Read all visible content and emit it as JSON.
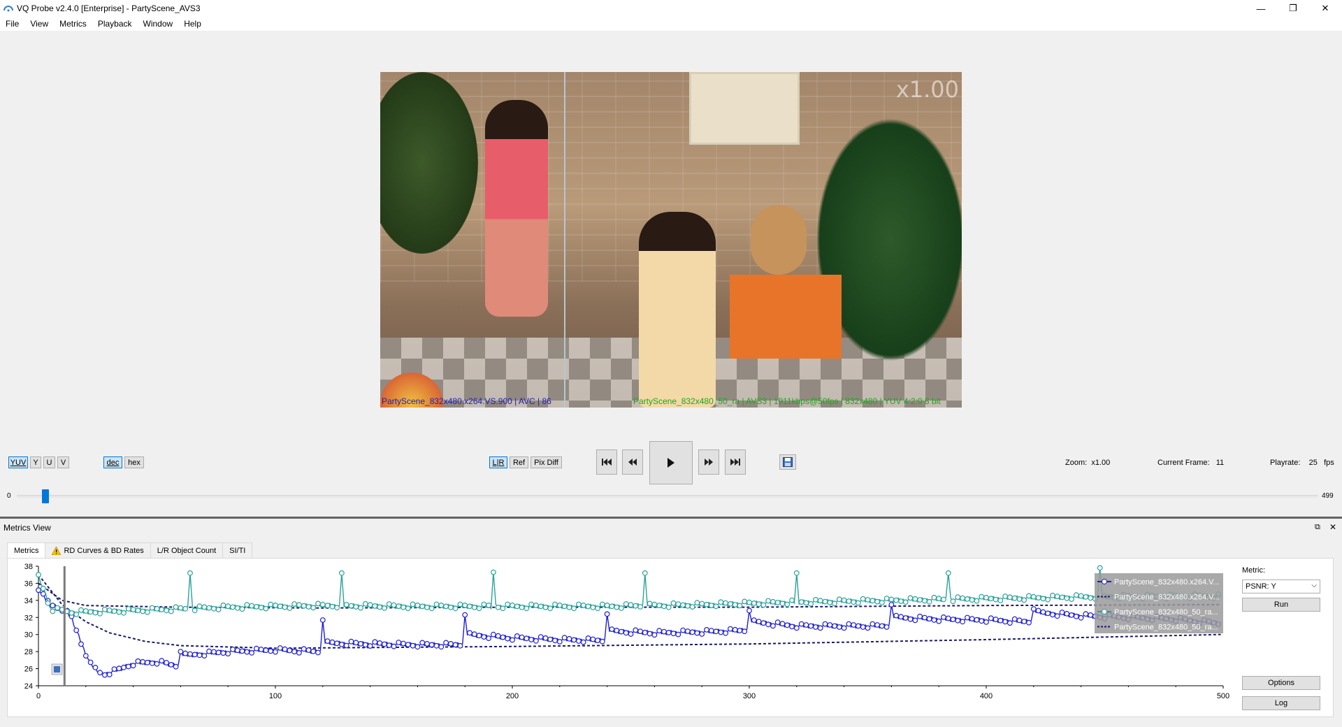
{
  "window": {
    "title": "VQ Probe v2.4.0 [Enterprise] - PartyScene_AVS3",
    "minimize_glyph": "—",
    "maximize_glyph": "❐",
    "close_glyph": "✕"
  },
  "menu": [
    "File",
    "View",
    "Metrics",
    "Playback",
    "Window",
    "Help"
  ],
  "video": {
    "zoom_overlay": "x1.00",
    "left_label": "PartyScene_832x480.x264.VS.900 | AVC | 86",
    "right_label": "PartyScene_832x480_50_ra | AVS3 | 1911kbps@50fps | 832x480 | YUV 4:2:0 8 bit"
  },
  "plane_buttons": [
    "YUV",
    "Y",
    "U",
    "V"
  ],
  "format_buttons": [
    "dec",
    "hex"
  ],
  "view_buttons": [
    "L|R",
    "Ref",
    "Pix Diff"
  ],
  "playback": {
    "zoom_label": "Zoom:",
    "zoom_value": "x1.00",
    "frame_label": "Current Frame:",
    "frame_value": "11",
    "playrate_label": "Playrate:",
    "playrate_value": "25",
    "playrate_unit": "fps",
    "slider_min": "0",
    "slider_max": "499",
    "slider_position": 11
  },
  "metrics_view": {
    "title": "Metrics View",
    "tabs": [
      "Metrics",
      "RD Curves & BD Rates",
      "L/R Object Count",
      "SI/TI"
    ],
    "active_tab": 0,
    "metric_label": "Metric:",
    "metric_value": "PSNR: Y",
    "run_label": "Run",
    "options_label": "Options",
    "log_label": "Log"
  },
  "colors": {
    "series_avc": "#1f1fd6",
    "series_avs3": "#2aa39a",
    "avg_line": "#1a1a6e",
    "accent": "#0078d7"
  },
  "chart_data": {
    "type": "line",
    "xlim": [
      0,
      500
    ],
    "ylim": [
      24,
      38
    ],
    "x_ticks": [
      0,
      100,
      200,
      300,
      400,
      500
    ],
    "y_ticks": [
      24,
      26,
      28,
      30,
      32,
      34,
      36,
      38
    ],
    "cursor_x": 11,
    "legend_position": "top-right",
    "series": [
      {
        "name": "PartyScene_832x480.x264.V...",
        "style": "circles-line",
        "color": "#1f1fd6",
        "baseline": [
          [
            0,
            35.2
          ],
          [
            5,
            33.5
          ],
          [
            10,
            33.0
          ],
          [
            14,
            32.0
          ],
          [
            18,
            29.0
          ],
          [
            22,
            26.5
          ],
          [
            27,
            25.3
          ],
          [
            33,
            25.8
          ],
          [
            40,
            26.6
          ],
          [
            50,
            26.8
          ],
          [
            59,
            26.3
          ],
          [
            60,
            27.5
          ],
          [
            80,
            28.0
          ],
          [
            100,
            28.2
          ],
          [
            119,
            28.0
          ],
          [
            120,
            29.0
          ],
          [
            140,
            28.9
          ],
          [
            160,
            28.8
          ],
          [
            179,
            28.8
          ],
          [
            180,
            30.0
          ],
          [
            200,
            29.6
          ],
          [
            220,
            29.4
          ],
          [
            239,
            29.3
          ],
          [
            240,
            30.4
          ],
          [
            260,
            30.2
          ],
          [
            280,
            30.3
          ],
          [
            299,
            30.5
          ],
          [
            300,
            31.5
          ],
          [
            320,
            31.0
          ],
          [
            340,
            31.0
          ],
          [
            359,
            31.0
          ],
          [
            360,
            32.0
          ],
          [
            380,
            31.8
          ],
          [
            400,
            31.7
          ],
          [
            419,
            31.5
          ],
          [
            420,
            32.6
          ],
          [
            440,
            32.2
          ],
          [
            460,
            32.0
          ],
          [
            480,
            31.8
          ],
          [
            499,
            31.3
          ]
        ],
        "spikes": [
          [
            0,
            35.2
          ],
          [
            60,
            28.0
          ],
          [
            120,
            31.7
          ],
          [
            180,
            32.3
          ],
          [
            240,
            32.4
          ],
          [
            300,
            32.8
          ],
          [
            360,
            33.5
          ],
          [
            420,
            33.0
          ]
        ]
      },
      {
        "name": "PartyScene_832x480.x264.V...",
        "style": "dashed",
        "color": "#1a1a6e",
        "points": [
          [
            0,
            37.0
          ],
          [
            10,
            33.5
          ],
          [
            20,
            31.5
          ],
          [
            30,
            30.2
          ],
          [
            45,
            29.2
          ],
          [
            60,
            28.7
          ],
          [
            100,
            28.4
          ],
          [
            200,
            28.6
          ],
          [
            300,
            28.9
          ],
          [
            400,
            29.4
          ],
          [
            499,
            30.0
          ]
        ]
      },
      {
        "name": "PartyScene_832x480_50_ra...",
        "style": "circles-line",
        "color": "#2aa39a",
        "baseline": [
          [
            0,
            37.0
          ],
          [
            5,
            33.0
          ],
          [
            15,
            32.6
          ],
          [
            40,
            32.8
          ],
          [
            80,
            33.2
          ],
          [
            120,
            33.4
          ],
          [
            160,
            33.3
          ],
          [
            200,
            33.3
          ],
          [
            240,
            33.3
          ],
          [
            280,
            33.5
          ],
          [
            320,
            33.8
          ],
          [
            360,
            34.0
          ],
          [
            400,
            34.2
          ],
          [
            440,
            34.4
          ],
          [
            499,
            34.5
          ]
        ],
        "spikes": [
          [
            0,
            37.0
          ],
          [
            64,
            37.2
          ],
          [
            128,
            37.2
          ],
          [
            192,
            37.3
          ],
          [
            256,
            37.2
          ],
          [
            320,
            37.2
          ],
          [
            384,
            37.2
          ],
          [
            448,
            37.8
          ]
        ]
      },
      {
        "name": "PartyScene_832x480_50_ra...",
        "style": "dashed",
        "color": "#1a1a6e",
        "points": [
          [
            0,
            36.0
          ],
          [
            10,
            34.0
          ],
          [
            20,
            33.4
          ],
          [
            60,
            33.2
          ],
          [
            120,
            33.1
          ],
          [
            200,
            33.2
          ],
          [
            300,
            33.2
          ],
          [
            400,
            33.4
          ],
          [
            499,
            33.5
          ]
        ]
      }
    ]
  }
}
